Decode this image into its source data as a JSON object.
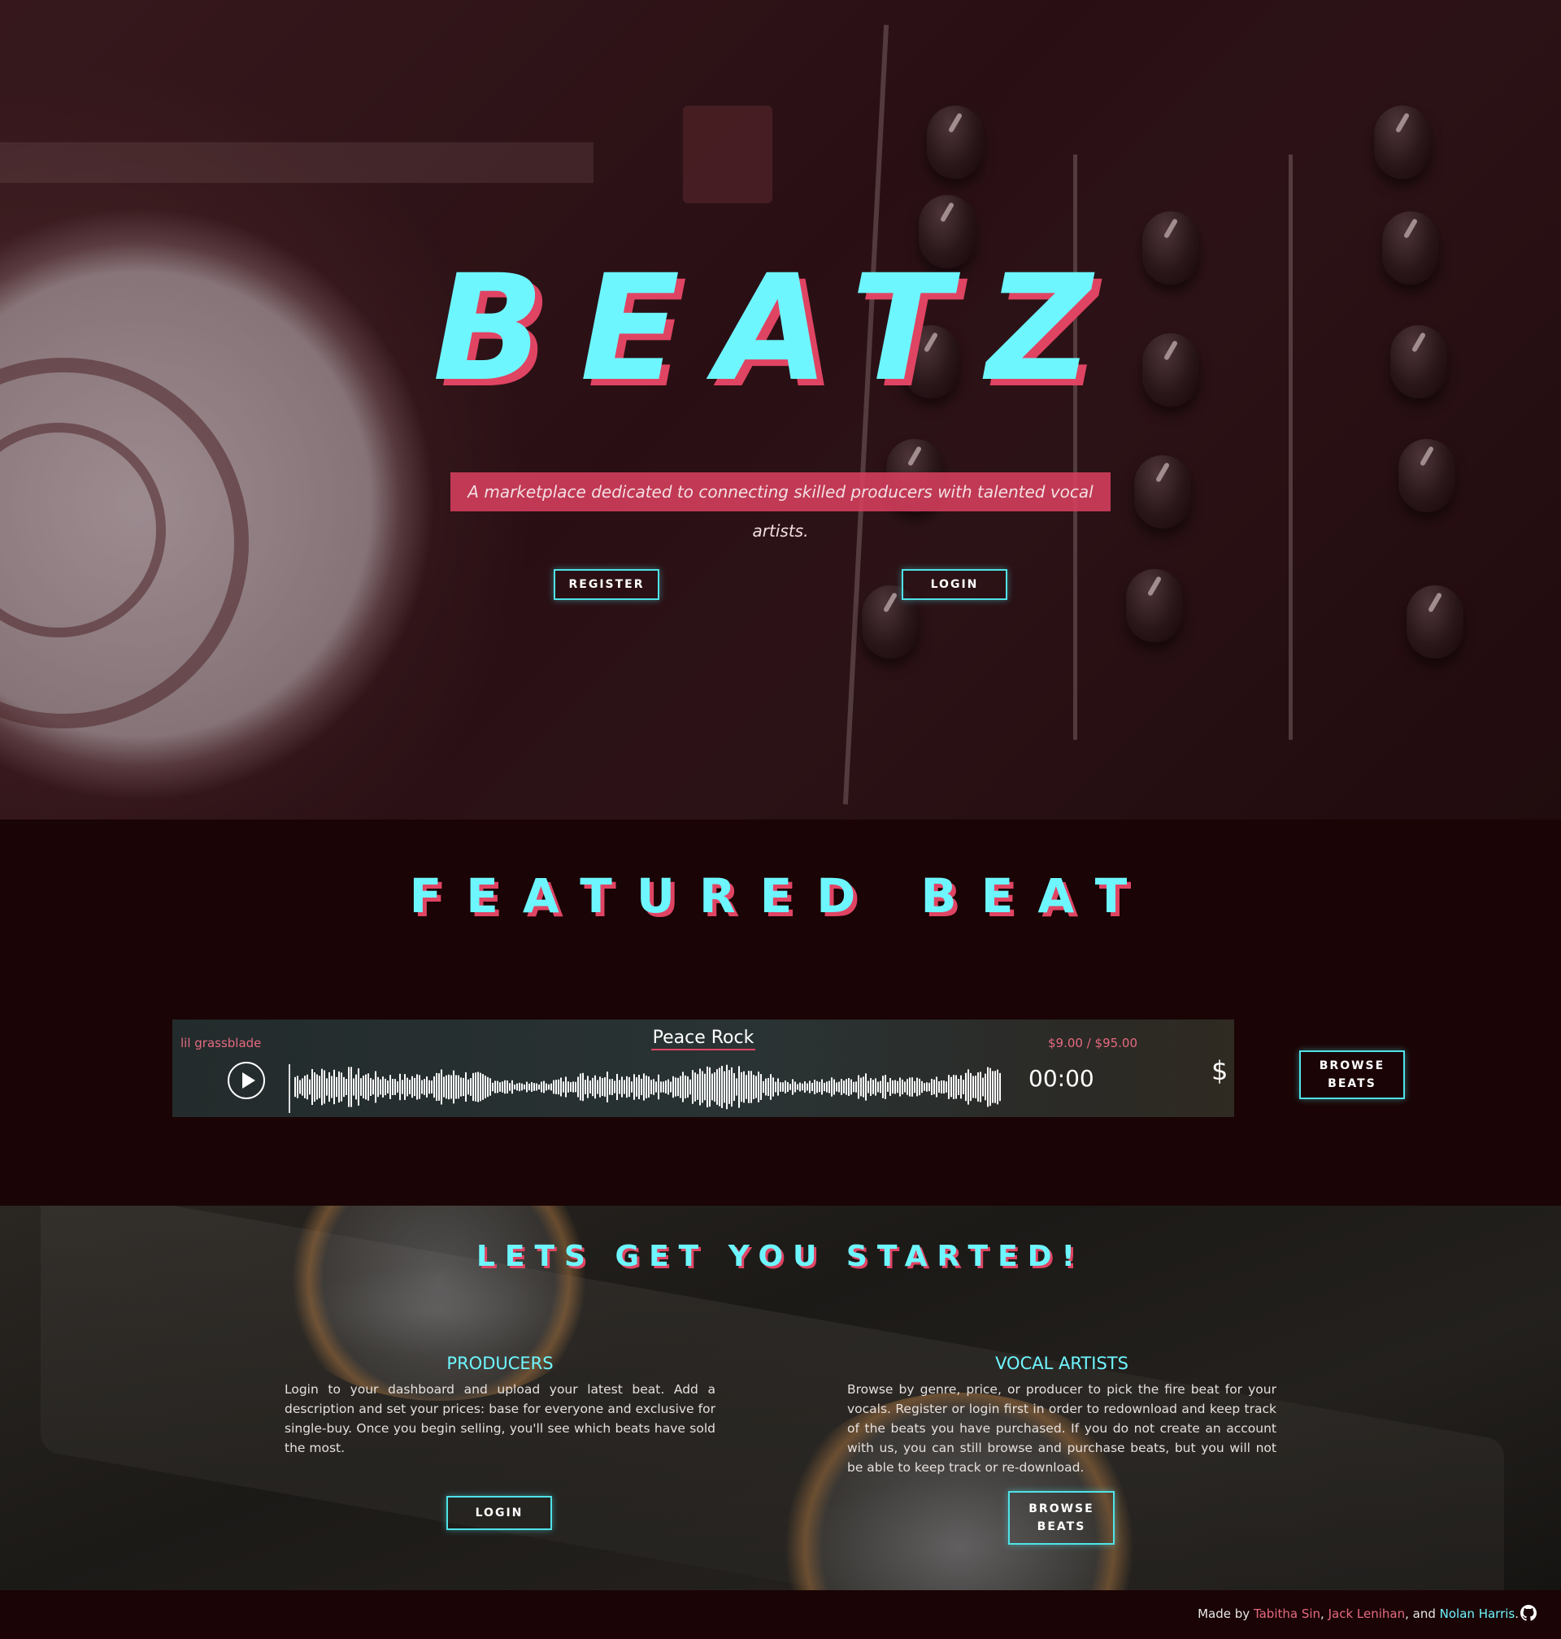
{
  "hero": {
    "logo": "BEATZ",
    "tagline": "A marketplace dedicated to connecting skilled producers with talented vocal artists.",
    "register_label": "REGISTER",
    "login_label": "LOGIN"
  },
  "featured": {
    "title": "FEATURED BEAT",
    "player": {
      "artist": "lil grassblade",
      "beat_title": "Peace Rock",
      "price": "$9.00 / $95.00",
      "time": "00:00",
      "buy_symbol": "$"
    },
    "browse_label_line1": "BROWSE",
    "browse_label_line2": "BEATS"
  },
  "started": {
    "title": "LETS GET YOU STARTED!",
    "producers": {
      "heading": "PRODUCERS",
      "text": "Login to your dashboard and upload your latest beat. Add a description and set your prices: base for everyone and exclusive for single-buy. Once you begin selling, you'll see which beats have sold the most.",
      "button_label": "LOGIN"
    },
    "vocal_artists": {
      "heading": "VOCAL ARTISTS",
      "text": "Browse by genre, price, or producer to pick the fire beat for your vocals. Register or login first in order to redownload and keep track of the beats you have purchased. If you do not create an account with us, you can still browse and purchase beats, but you will not be able to keep track or re-download.",
      "button_label_line1": "BROWSE",
      "button_label_line2": "BEATS"
    }
  },
  "footer": {
    "made_by": "Made by ",
    "name1": "Tabitha Sin",
    "sep1": ", ",
    "name2": "Jack Lenihan",
    "sep2": ", and ",
    "name3": "Nolan Harris",
    "end": ".",
    "icon": "github-icon"
  },
  "colors": {
    "accent_cyan": "#6ef6ff",
    "accent_pink": "#e04463",
    "background": "#1a0405"
  }
}
